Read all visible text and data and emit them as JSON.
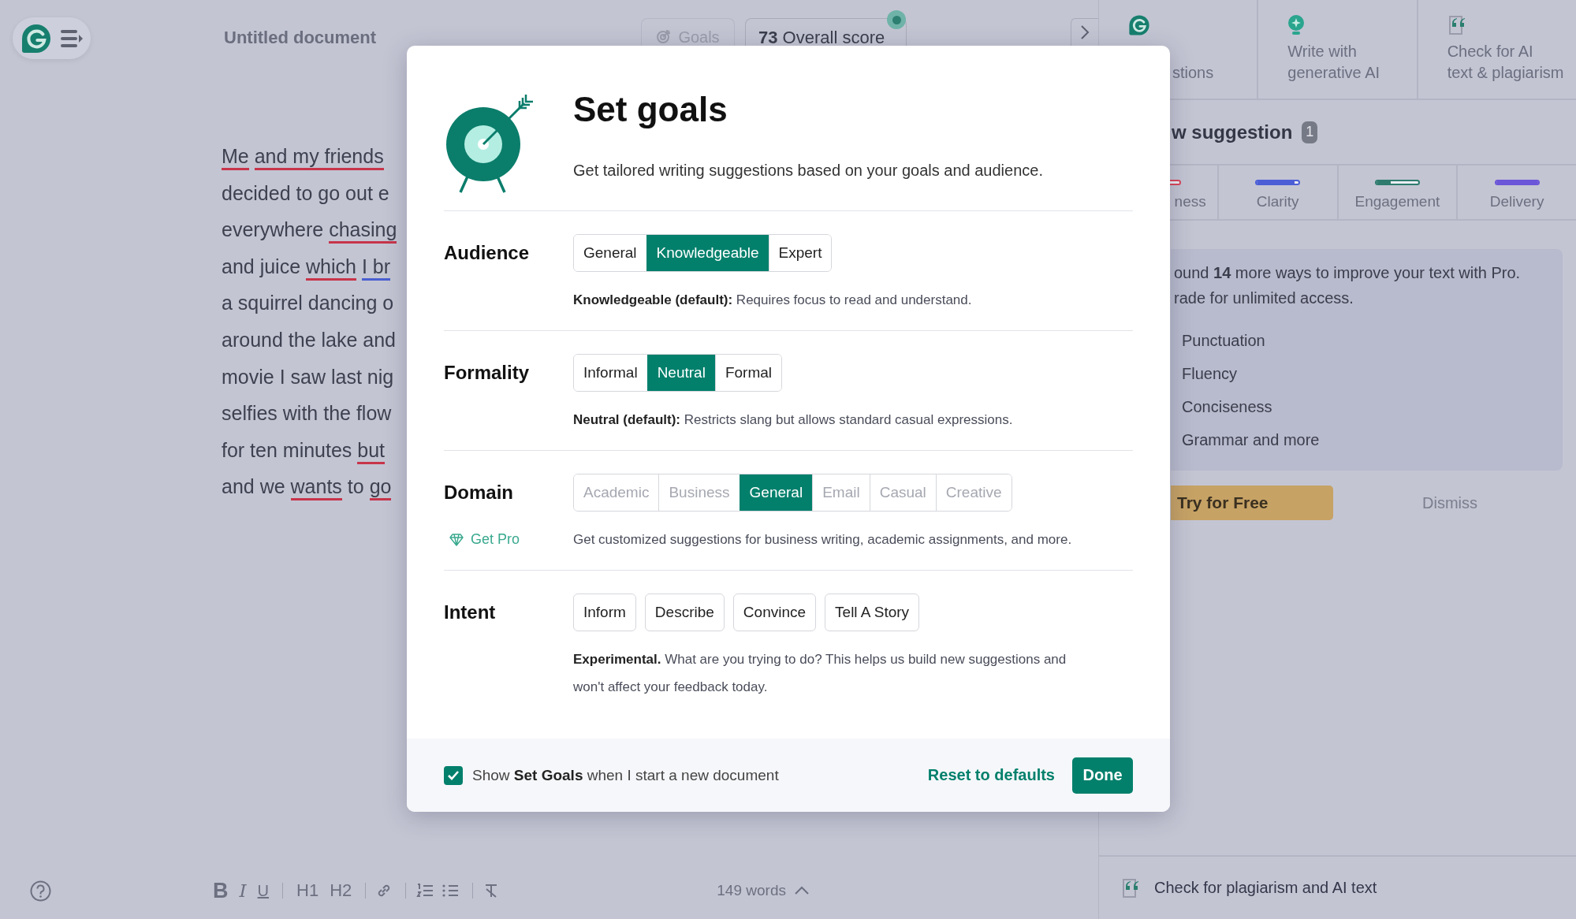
{
  "header": {
    "title": "Untitled document",
    "goals_button": "Goals",
    "score": "**73** Overall score"
  },
  "editor": {
    "lines": [
      [
        {
          "text": "Me",
          "color": "#c7354a"
        },
        {
          "text": " and my friends",
          "color": "#c7354a"
        }
      ],
      [
        {
          "text": "decided to go out e"
        }
      ],
      [
        {
          "text": "everywhere "
        },
        {
          "text": "chasing",
          "color": "#c7354a"
        }
      ],
      [
        {
          "text": "and juice "
        },
        {
          "text": "which",
          "color": "#c7354a"
        },
        {
          "text": " I br",
          "color": "#4a5fd0"
        }
      ],
      [
        {
          "text": "a squirrel dancing o"
        }
      ],
      [
        {
          "text": "around the lake and"
        }
      ],
      [
        {
          "text": "movie I saw last nig"
        }
      ],
      [
        {
          "text": "selfies with the flow"
        }
      ],
      [
        {
          "text": "for ten minutes "
        },
        {
          "text": "but",
          "color": "#c7354a"
        }
      ],
      [
        {
          "text": "and we "
        },
        {
          "text": "wants",
          "color": "#c7354a"
        },
        {
          "text": " to "
        },
        {
          "text": "go",
          "color": "#c7354a"
        }
      ]
    ]
  },
  "toolbar": {
    "format_buttons": [
      {
        "label": "B",
        "kind": "bold"
      },
      {
        "label": "I",
        "kind": "italic"
      },
      {
        "label": "U",
        "kind": "underline"
      },
      {
        "label": "H1",
        "kind": "heading"
      },
      {
        "label": "H2",
        "kind": "heading"
      }
    ],
    "word_count": "149 words"
  },
  "right_panel": {
    "tabs": [
      {
        "lines": [
          "stions"
        ]
      },
      {
        "lines": [
          "Write with",
          "generative AI"
        ]
      },
      {
        "lines": [
          "Check for AI",
          "text & plagiarism"
        ]
      }
    ],
    "heading": "w suggestion",
    "count": "1",
    "categories": [
      {
        "label": "ness",
        "color": "#d9475a"
      },
      {
        "label": "Clarity",
        "color": "#4c5ed6",
        "level": 0.9
      },
      {
        "label": "Engagement",
        "color": "#2f7c6e",
        "level": 0.35
      },
      {
        "label": "Delivery",
        "color": "#6b55d8",
        "level": 1
      }
    ],
    "promo": {
      "text": "ound **14** more ways to improve your text with Pro.",
      "text_2": "rade for unlimited access.",
      "features": [
        "Punctuation",
        "Fluency",
        "Conciseness",
        "Grammar and more"
      ],
      "primary_button": "Try for Free",
      "secondary_button": "Dismiss"
    },
    "footer": "Check for plagiarism and AI text"
  },
  "modal": {
    "title": "Set goals",
    "subtitle": "Get tailored writing suggestions based on your goals and audience.",
    "sections": [
      {
        "label": "Audience",
        "kind": "segmented",
        "options": [
          {
            "label": "General",
            "selected": false,
            "disabled": false
          },
          {
            "label": "Knowledgeable",
            "selected": true,
            "disabled": false
          },
          {
            "label": "Expert",
            "selected": false,
            "disabled": false
          }
        ],
        "description": "**Knowledgeable (default):** Requires focus to read and understand."
      },
      {
        "label": "Formality",
        "kind": "segmented",
        "options": [
          {
            "label": "Informal",
            "selected": false,
            "disabled": false
          },
          {
            "label": "Neutral",
            "selected": true,
            "disabled": false
          },
          {
            "label": "Formal",
            "selected": false,
            "disabled": false
          }
        ],
        "description": "**Neutral (default):** Restricts slang but allows standard casual expressions."
      },
      {
        "label": "Domain",
        "kind": "segmented",
        "pro_link": "Get Pro",
        "options": [
          {
            "label": "Academic",
            "selected": false,
            "disabled": true
          },
          {
            "label": "Business",
            "selected": false,
            "disabled": true
          },
          {
            "label": "General",
            "selected": true,
            "disabled": false
          },
          {
            "label": "Email",
            "selected": false,
            "disabled": true
          },
          {
            "label": "Casual",
            "selected": false,
            "disabled": true
          },
          {
            "label": "Creative",
            "selected": false,
            "disabled": true
          }
        ],
        "description": "Get customized suggestions for business writing, academic assignments, and more."
      },
      {
        "label": "Intent",
        "kind": "chips",
        "options": [
          {
            "label": "Inform",
            "selected": false
          },
          {
            "label": "Describe",
            "selected": false
          },
          {
            "label": "Convince",
            "selected": false
          },
          {
            "label": "Tell A Story",
            "selected": false
          }
        ],
        "description": "**Experimental.** What are you trying to do? This helps us build new suggestions and won't affect your feedback today."
      }
    ],
    "footer": {
      "checkbox": {
        "label": "Show **Set Goals** when I start a new document",
        "checked": true
      },
      "reset_button": "Reset to defaults",
      "done_button": "Done"
    }
  }
}
